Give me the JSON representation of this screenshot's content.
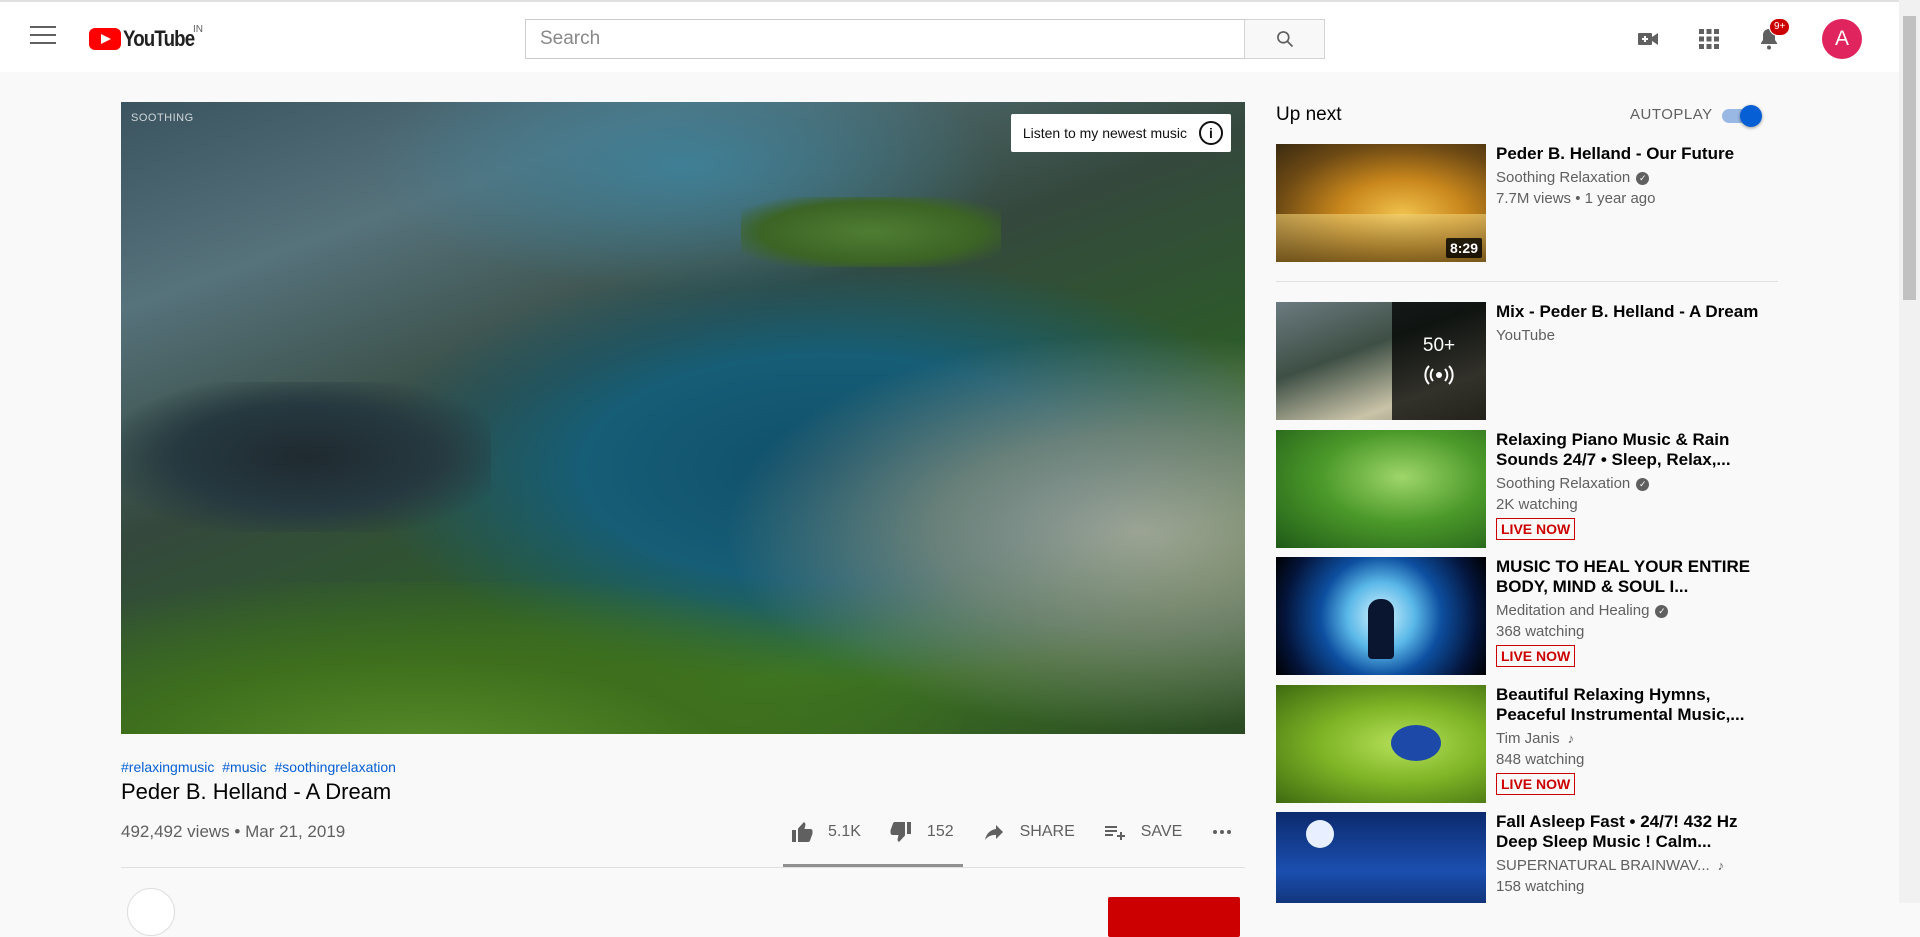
{
  "header": {
    "logo_text": "YouTube",
    "country_code": "IN",
    "search_placeholder": "Search",
    "notification_count": "9+",
    "avatar_letter": "A"
  },
  "player": {
    "watermark": "SOOTHING",
    "info_card_text": "Listen to my newest music",
    "info_icon": "i"
  },
  "video": {
    "hashtags": [
      "#relaxingmusic",
      "#music",
      "#soothingrelaxation"
    ],
    "title": "Peder B. Helland - A Dream",
    "meta": "492,492 views • Mar 21, 2019",
    "likes": "5.1K",
    "dislikes": "152",
    "share_label": "SHARE",
    "save_label": "SAVE",
    "like_ratio": 0.8
  },
  "sidebar": {
    "upnext_label": "Up next",
    "autoplay_label": "AUTOPLAY",
    "autoplay_on": true,
    "items": [
      {
        "title": "Peder B. Helland - Our Future",
        "channel": "Soothing Relaxation",
        "meta": "7.7M views • 1 year ago",
        "duration": "8:29"
      },
      {
        "title": "Mix - Peder B. Helland - A Dream",
        "channel": "YouTube",
        "mix_count": "50+"
      },
      {
        "title": "Relaxing Piano Music & Rain Sounds 24/7 • Sleep, Relax,...",
        "channel": "Soothing Relaxation",
        "meta": "2K watching",
        "live": "LIVE NOW"
      },
      {
        "title": "MUSIC TO HEAL YOUR ENTIRE BODY, MIND & SOUL I...",
        "channel": "Meditation and Healing",
        "meta": "368 watching",
        "live": "LIVE NOW"
      },
      {
        "title": "Beautiful Relaxing Hymns, Peaceful Instrumental Music,...",
        "channel": "Tim Janis",
        "meta": "848 watching",
        "live": "LIVE NOW"
      },
      {
        "title": "Fall Asleep Fast • 24/7! 432 Hz Deep Sleep Music ! Calm...",
        "channel": "SUPERNATURAL BRAINWAV...",
        "meta": "158 watching"
      }
    ]
  }
}
